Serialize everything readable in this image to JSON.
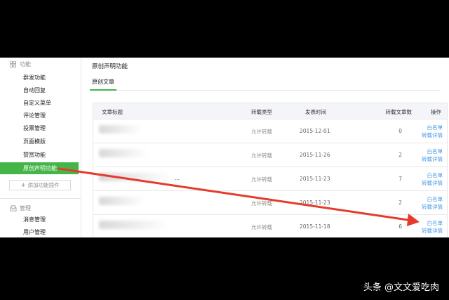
{
  "sidebar": {
    "section_function": "功能",
    "function_items": [
      {
        "label": "群发功能"
      },
      {
        "label": "自动回复"
      },
      {
        "label": "自定义菜单"
      },
      {
        "label": "评论管理"
      },
      {
        "label": "投票管理"
      },
      {
        "label": "页面模版"
      },
      {
        "label": "赞赏功能"
      },
      {
        "label": "原创声明功能",
        "active": true
      }
    ],
    "add_plugin": "添加功能插件",
    "section_manage": "管理",
    "manage_items": [
      {
        "label": "消息管理"
      },
      {
        "label": "用户管理"
      }
    ]
  },
  "main": {
    "page_title": "原创声明功能",
    "tab": "原创文章",
    "table": {
      "headers": {
        "title": "文章标题",
        "type": "转载类型",
        "time": "发表时间",
        "count": "转载文章数",
        "op": "操作"
      },
      "rows": [
        {
          "title": "",
          "type": "允许转载",
          "time": "2015-12-01",
          "count": "0",
          "op1": "白名单",
          "op2": "转载详情"
        },
        {
          "title": "",
          "type": "允许转载",
          "time": "2015-11-26",
          "count": "2",
          "op1": "白名单",
          "op2": "转载详情"
        },
        {
          "title": "...",
          "type": "允许转载",
          "time": "2015-11-23",
          "count": "7",
          "op1": "白名单",
          "op2": "转载详情"
        },
        {
          "title": "",
          "type": "允许转载",
          "time": "2015-11-23",
          "count": "2",
          "op1": "白名单",
          "op2": "转载详情"
        },
        {
          "title": "",
          "type": "允许转载",
          "time": "2015-11-18",
          "count": "6",
          "op1": "白名单",
          "op2": "转载详情"
        }
      ]
    }
  },
  "watermark": "头条 @文文爱吃肉",
  "colors": {
    "accent_green": "#44b549",
    "link_blue": "#459ae9",
    "arrow_red": "#e53b2c"
  },
  "icons": {
    "function": "grid-icon",
    "manage": "inbox-icon",
    "add": "plus-icon"
  }
}
